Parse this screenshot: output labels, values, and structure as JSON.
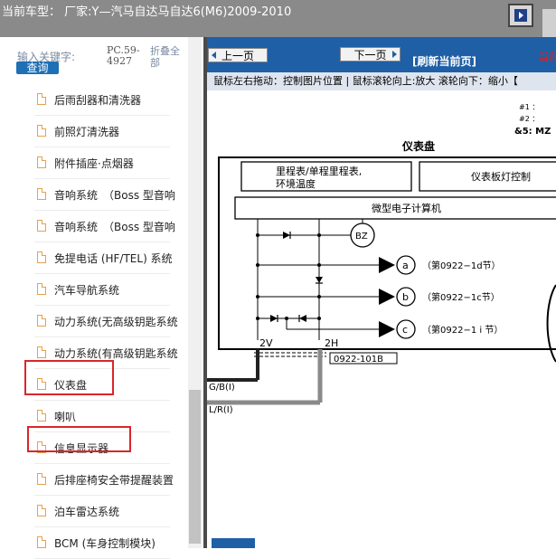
{
  "header": {
    "title": "当前车型：  厂家:Y—汽马自达马自达6(M6)2009-2010"
  },
  "search": {
    "label": "输入关键字:",
    "code": "PC.59-4927",
    "collapse_label": "折叠全部",
    "query_button": "查询"
  },
  "tree": {
    "items": [
      {
        "label": "后雨刮器和清洗器"
      },
      {
        "label": "前照灯清洗器"
      },
      {
        "label": "附件插座·点烟器"
      },
      {
        "label": "音响系统　（Boss 型音响"
      },
      {
        "label": "音响系统　（Boss 型音响"
      },
      {
        "label": "免提电话 (HF/TEL) 系统"
      },
      {
        "label": "汽车导航系统"
      },
      {
        "label": "动力系统(无高级钥匙系统"
      },
      {
        "label": "动力系统(有高级钥匙系统"
      },
      {
        "label": "仪表盘"
      },
      {
        "label": "喇叭"
      },
      {
        "label": "信息显示器"
      },
      {
        "label": "后排座椅安全带提醒装置"
      },
      {
        "label": "泊车雷达系统"
      },
      {
        "label": "BCM (车身控制模块)"
      }
    ]
  },
  "viewer": {
    "prev_button": "上一页",
    "next_button": "下一页",
    "refresh_label": "[刷新当前页]",
    "current_page_label": "当前",
    "hint": "鼠标左右拖动：控制图片位置 | 鼠标滚轮向上:放大  滚轮向下：缩小【"
  },
  "diagram": {
    "notes": [
      "#1 ：",
      "#2 ：",
      "&5: MZ"
    ],
    "title": "仪表盘",
    "box_odometer": "里程表/单程里程表,",
    "box_odometer_line2": "环境温度",
    "box_panel_light": "仪表板灯控制",
    "box_computer": "微型电子计算机",
    "buzzer": "BZ",
    "conn_a": "a",
    "conn_b": "b",
    "conn_c": "c",
    "ref_a": "（第0922−1d节）",
    "ref_b": "（第0922−1c节）",
    "ref_c": "（第0922−1 i 节）",
    "pin_2v": "2V",
    "pin_2h": "2H",
    "connector_code": "0922-101B",
    "wire_gb": "G/B(I)",
    "wire_lr": "L/R(I)"
  }
}
